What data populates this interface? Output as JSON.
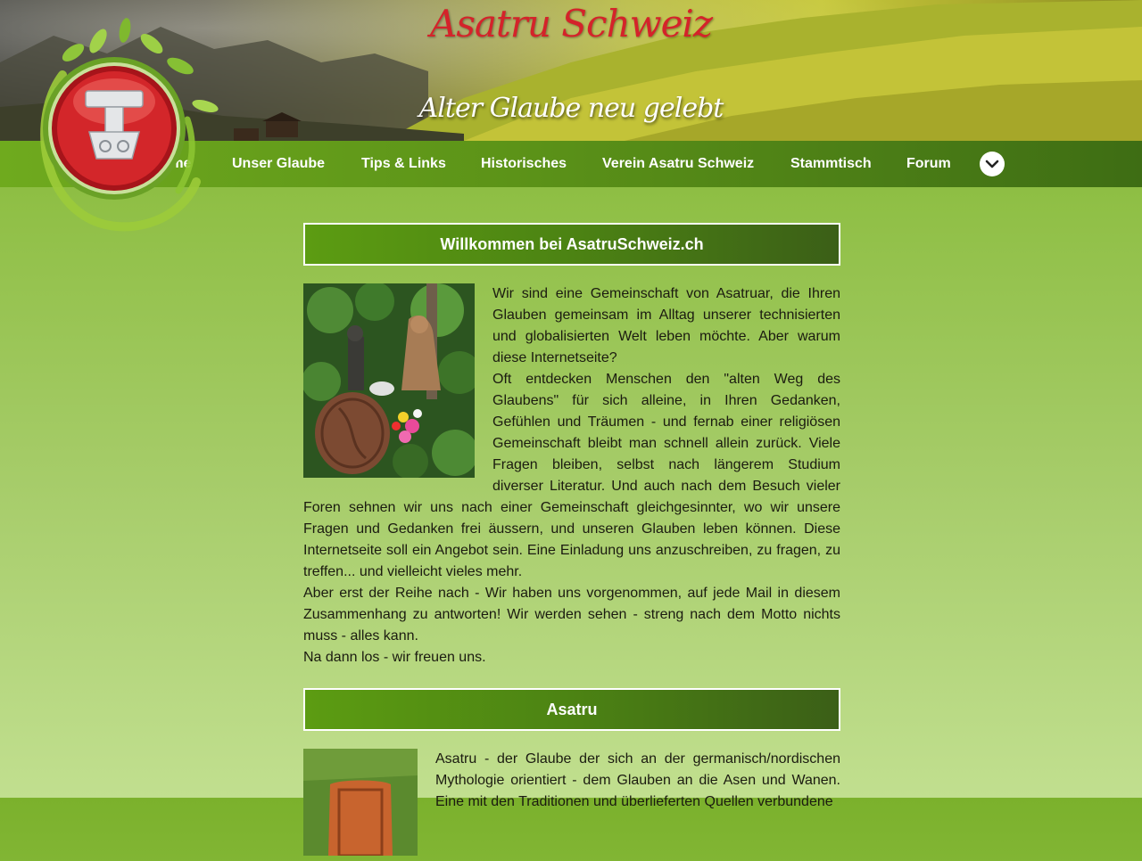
{
  "header": {
    "title": "Asatru Schweiz",
    "subtitle": "Alter Glaube neu gelebt"
  },
  "logo": {
    "icon": "thors-hammer-icon"
  },
  "nav": {
    "items": [
      {
        "label": "Home"
      },
      {
        "label": "Unser Glaube"
      },
      {
        "label": "Tips & Links"
      },
      {
        "label": "Historisches"
      },
      {
        "label": "Verein Asatru Schweiz"
      },
      {
        "label": "Stammtisch"
      },
      {
        "label": "Forum"
      }
    ],
    "more_icon": "chevron-down-icon"
  },
  "sections": [
    {
      "title": "Willkommen bei AsatruSchweiz.ch",
      "image": "altar-photo",
      "paragraphs": [
        "Wir sind eine Gemeinschaft von Asatruar, die Ihren Glauben gemeinsam im Alltag unserer technisierten und globalisierten Welt leben möchte. Aber warum diese Internetseite?",
        "Oft entdecken Menschen den \"alten Weg des Glaubens\" für sich alleine, in Ihren Gedanken, Gefühlen und Träumen - und fernab einer religiösen Gemeinschaft bleibt man schnell allein zurück. Viele Fragen bleiben, selbst nach längerem Studium diverser Literatur. Und auch nach dem Besuch vieler Foren sehnen wir uns nach einer Gemeinschaft gleichgesinnter, wo wir unsere Fragen und Gedanken frei äussern, und unseren Glauben leben können. Diese Internetseite soll ein Angebot sein. Eine Einladung uns anzuschreiben, zu fragen, zu treffen... und vielleicht vieles mehr.",
        "Aber erst der Reihe nach - Wir haben uns vorgenommen, auf jede Mail in diesem Zusammenhang zu antworten! Wir werden sehen - streng nach dem Motto nichts muss - alles kann.",
        "Na dann los - wir freuen uns."
      ]
    },
    {
      "title": "Asatru",
      "image": "wooden-plaque-photo",
      "paragraphs": [
        "Asatru - der Glaube der sich an der germanisch/nordischen Mythologie orientiert - dem Glauben an die Asen und Wanen. Eine mit den Traditionen und überlieferten Quellen verbundene"
      ]
    }
  ]
}
